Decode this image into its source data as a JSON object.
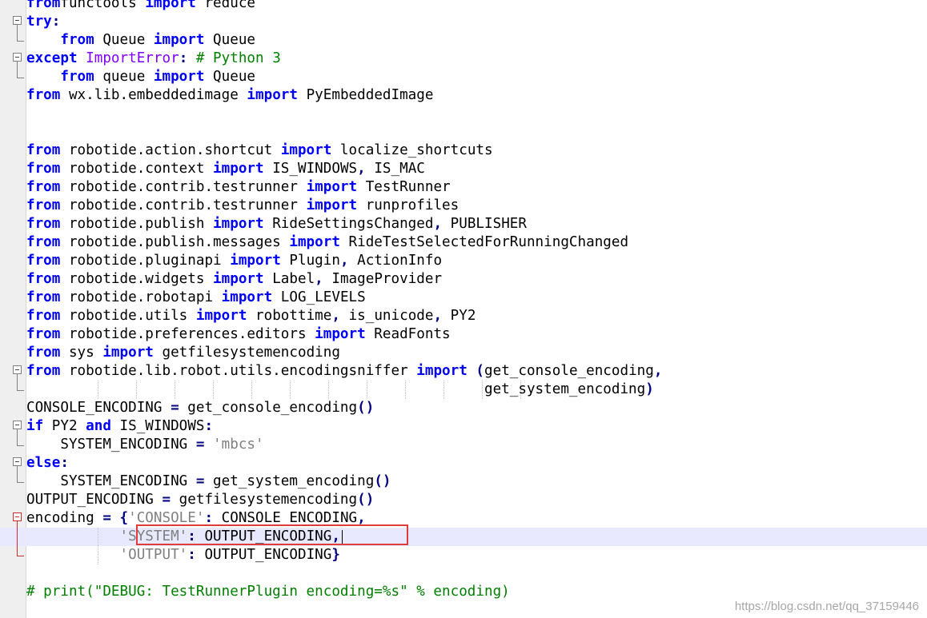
{
  "editor": {
    "current_line_index": 29,
    "lines": [
      {
        "fold": "",
        "tokens": [
          [
            "kw",
            "from"
          ],
          [
            "",
            "functools "
          ],
          [
            "kw",
            "import"
          ],
          [
            "",
            " reduce"
          ]
        ]
      },
      {
        "fold": "open",
        "tokens": [
          [
            "kw",
            "try"
          ],
          [
            "op",
            ":"
          ]
        ]
      },
      {
        "fold": "end",
        "tokens": [
          [
            "",
            "    "
          ],
          [
            "kw",
            "from"
          ],
          [
            "",
            " Queue "
          ],
          [
            "kw",
            "import"
          ],
          [
            "",
            " Queue"
          ]
        ]
      },
      {
        "fold": "open",
        "tokens": [
          [
            "kw",
            "except"
          ],
          [
            "",
            " "
          ],
          [
            "exc",
            "ImportError"
          ],
          [
            "op",
            ":"
          ],
          [
            "",
            " "
          ],
          [
            "cm",
            "# Python 3"
          ]
        ]
      },
      {
        "fold": "end",
        "tokens": [
          [
            "",
            "    "
          ],
          [
            "kw",
            "from"
          ],
          [
            "",
            " queue "
          ],
          [
            "kw",
            "import"
          ],
          [
            "",
            " Queue"
          ]
        ]
      },
      {
        "fold": "",
        "tokens": [
          [
            "kw",
            "from"
          ],
          [
            "",
            " wx.lib.embeddedimage "
          ],
          [
            "kw",
            "import"
          ],
          [
            "",
            " PyEmbeddedImage"
          ]
        ]
      },
      {
        "fold": "",
        "tokens": []
      },
      {
        "fold": "",
        "tokens": []
      },
      {
        "fold": "",
        "tokens": [
          [
            "kw",
            "from"
          ],
          [
            "",
            " robotide.action.shortcut "
          ],
          [
            "kw",
            "import"
          ],
          [
            "",
            " localize_shortcuts"
          ]
        ]
      },
      {
        "fold": "",
        "tokens": [
          [
            "kw",
            "from"
          ],
          [
            "",
            " robotide.context "
          ],
          [
            "kw",
            "import"
          ],
          [
            "",
            " IS_WINDOWS"
          ],
          [
            "op",
            ","
          ],
          [
            "",
            " IS_MAC"
          ]
        ]
      },
      {
        "fold": "",
        "tokens": [
          [
            "kw",
            "from"
          ],
          [
            "",
            " robotide.contrib.testrunner "
          ],
          [
            "kw",
            "import"
          ],
          [
            "",
            " TestRunner"
          ]
        ]
      },
      {
        "fold": "",
        "tokens": [
          [
            "kw",
            "from"
          ],
          [
            "",
            " robotide.contrib.testrunner "
          ],
          [
            "kw",
            "import"
          ],
          [
            "",
            " runprofiles"
          ]
        ]
      },
      {
        "fold": "",
        "tokens": [
          [
            "kw",
            "from"
          ],
          [
            "",
            " robotide.publish "
          ],
          [
            "kw",
            "import"
          ],
          [
            "",
            " RideSettingsChanged"
          ],
          [
            "op",
            ","
          ],
          [
            "",
            " PUBLISHER"
          ]
        ]
      },
      {
        "fold": "",
        "tokens": [
          [
            "kw",
            "from"
          ],
          [
            "",
            " robotide.publish.messages "
          ],
          [
            "kw",
            "import"
          ],
          [
            "",
            " RideTestSelectedForRunningChanged"
          ]
        ]
      },
      {
        "fold": "",
        "tokens": [
          [
            "kw",
            "from"
          ],
          [
            "",
            " robotide.pluginapi "
          ],
          [
            "kw",
            "import"
          ],
          [
            "",
            " Plugin"
          ],
          [
            "op",
            ","
          ],
          [
            "",
            " ActionInfo"
          ]
        ]
      },
      {
        "fold": "",
        "tokens": [
          [
            "kw",
            "from"
          ],
          [
            "",
            " robotide.widgets "
          ],
          [
            "kw",
            "import"
          ],
          [
            "",
            " Label"
          ],
          [
            "op",
            ","
          ],
          [
            "",
            " ImageProvider"
          ]
        ]
      },
      {
        "fold": "",
        "tokens": [
          [
            "kw",
            "from"
          ],
          [
            "",
            " robotide.robotapi "
          ],
          [
            "kw",
            "import"
          ],
          [
            "",
            " LOG_LEVELS"
          ]
        ]
      },
      {
        "fold": "",
        "tokens": [
          [
            "kw",
            "from"
          ],
          [
            "",
            " robotide.utils "
          ],
          [
            "kw",
            "import"
          ],
          [
            "",
            " robottime"
          ],
          [
            "op",
            ","
          ],
          [
            "",
            " is_unicode"
          ],
          [
            "op",
            ","
          ],
          [
            "",
            " PY2"
          ]
        ]
      },
      {
        "fold": "",
        "tokens": [
          [
            "kw",
            "from"
          ],
          [
            "",
            " robotide.preferences.editors "
          ],
          [
            "kw",
            "import"
          ],
          [
            "",
            " ReadFonts"
          ]
        ]
      },
      {
        "fold": "",
        "tokens": [
          [
            "kw",
            "from"
          ],
          [
            "",
            " sys "
          ],
          [
            "kw",
            "import"
          ],
          [
            "",
            " getfilesystemencoding"
          ]
        ]
      },
      {
        "fold": "open",
        "tokens": [
          [
            "kw",
            "from"
          ],
          [
            "",
            " robotide.lib.robot.utils.encodingsniffer "
          ],
          [
            "kw",
            "import"
          ],
          [
            "",
            " "
          ],
          [
            "op",
            "("
          ],
          [
            "",
            "get_console_encoding"
          ],
          [
            "op",
            ","
          ]
        ]
      },
      {
        "fold": "end",
        "guides": true,
        "tokens": [
          [
            "",
            "                                                      get_system_encoding"
          ],
          [
            "op",
            ")"
          ]
        ]
      },
      {
        "fold": "",
        "tokens": [
          [
            "",
            "CONSOLE_ENCODING "
          ],
          [
            "op",
            "="
          ],
          [
            "",
            " get_console_encoding"
          ],
          [
            "op",
            "()"
          ]
        ]
      },
      {
        "fold": "open",
        "tokens": [
          [
            "kw",
            "if"
          ],
          [
            "",
            " PY2 "
          ],
          [
            "kw",
            "and"
          ],
          [
            "",
            " IS_WINDOWS"
          ],
          [
            "op",
            ":"
          ]
        ]
      },
      {
        "fold": "end",
        "tokens": [
          [
            "",
            "    SYSTEM_ENCODING "
          ],
          [
            "op",
            "="
          ],
          [
            "",
            " "
          ],
          [
            "str",
            "'mbcs'"
          ]
        ]
      },
      {
        "fold": "open",
        "tokens": [
          [
            "kw",
            "else"
          ],
          [
            "op",
            ":"
          ]
        ]
      },
      {
        "fold": "end",
        "tokens": [
          [
            "",
            "    SYSTEM_ENCODING "
          ],
          [
            "op",
            "="
          ],
          [
            "",
            " get_system_encoding"
          ],
          [
            "op",
            "()"
          ]
        ]
      },
      {
        "fold": "",
        "tokens": [
          [
            "",
            "OUTPUT_ENCODING "
          ],
          [
            "op",
            "="
          ],
          [
            "",
            " getfilesystemencoding"
          ],
          [
            "op",
            "()"
          ]
        ]
      },
      {
        "fold": "open-red",
        "tokens": [
          [
            "",
            "encoding "
          ],
          [
            "op",
            "="
          ],
          [
            "",
            " "
          ],
          [
            "op",
            "{"
          ],
          [
            "str",
            "'CONSOLE'"
          ],
          [
            "op",
            ":"
          ],
          [
            "",
            " CONSOLE_ENCODING"
          ],
          [
            "op",
            ","
          ]
        ]
      },
      {
        "fold": "mid-red",
        "guides": true,
        "tokens": [
          [
            "",
            "           "
          ],
          [
            "str",
            "'SYSTEM'"
          ],
          [
            "op",
            ":"
          ],
          [
            "",
            " OUTPUT_ENCODING"
          ],
          [
            "op",
            ","
          ]
        ]
      },
      {
        "fold": "end-red",
        "guides": true,
        "tokens": [
          [
            "",
            "           "
          ],
          [
            "str",
            "'OUTPUT'"
          ],
          [
            "op",
            ":"
          ],
          [
            "",
            " OUTPUT_ENCODING"
          ],
          [
            "op",
            "}"
          ]
        ]
      },
      {
        "fold": "",
        "tokens": []
      },
      {
        "fold": "",
        "tokens": [
          [
            "cm",
            "# print(\"DEBUG: TestRunnerPlugin encoding=%s\" % encoding)"
          ]
        ]
      }
    ]
  },
  "watermark": "https://blog.csdn.net/qq_37159446"
}
